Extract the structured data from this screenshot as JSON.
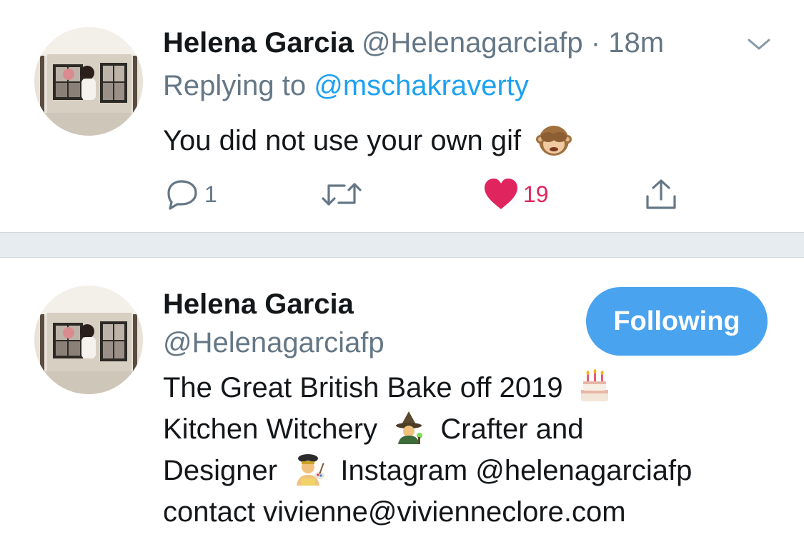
{
  "tweet": {
    "author_name": "Helena Garcia",
    "author_handle": "@Helenagarciafp",
    "separator_dot": "·",
    "time": "18m",
    "reply_prefix": "Replying to",
    "reply_to_handle": "@mschakraverty",
    "text": "You did not use your own gif",
    "text_emoji": "see-no-evil-monkey",
    "actions": {
      "reply_count": "1",
      "retweet_count": "",
      "like_count": "19",
      "liked": true
    },
    "icons": [
      "avatar",
      "chevron-down-icon",
      "reply-icon",
      "retweet-icon",
      "heart-icon",
      "share-icon"
    ]
  },
  "profile": {
    "name": "Helena Garcia",
    "handle": "@Helenagarciafp",
    "follow_button_label": "Following",
    "bio": {
      "line1": "The Great British Bake off 2019",
      "line1_emoji": "birthday-cake",
      "line2_a": "Kitchen Witchery",
      "line2_emoji": "witch",
      "line2_b": "Crafter and",
      "line3_a": "Designer",
      "line3_emoji": "artist",
      "line3_b": "Instagram @helenagarciafp",
      "line4": "contact vivienne@vivienneclore.com"
    }
  },
  "colors": {
    "link_blue": "#1da1f2",
    "follow_button": "#4aa3ef",
    "like_red": "#e0245e",
    "muted_text": "#657786",
    "separator": "#e6ecf0"
  }
}
